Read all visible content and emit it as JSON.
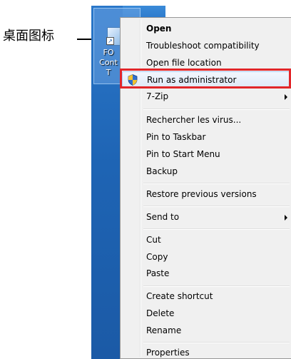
{
  "annotation": {
    "label": "桌面图标"
  },
  "desktop_icon": {
    "lines": [
      "FO",
      "Cont",
      "T"
    ]
  },
  "context_menu": {
    "items": [
      {
        "label": "Open",
        "bold": true
      },
      {
        "label": "Troubleshoot compatibility"
      },
      {
        "label": "Open file location"
      },
      {
        "label": "Run as administrator",
        "icon": "uac-shield-icon",
        "highlighted": true
      },
      {
        "label": "7-Zip",
        "submenu": true
      },
      {
        "label": "Rechercher les virus..."
      },
      {
        "label": "Pin to Taskbar"
      },
      {
        "label": "Pin to Start Menu"
      },
      {
        "label": "Backup"
      },
      {
        "label": "Restore previous versions"
      },
      {
        "label": "Send to",
        "submenu": true
      },
      {
        "label": "Cut"
      },
      {
        "label": "Copy"
      },
      {
        "label": "Paste"
      },
      {
        "label": "Create shortcut"
      },
      {
        "label": "Delete"
      },
      {
        "label": "Rename"
      },
      {
        "label": "Properties"
      }
    ]
  },
  "colors": {
    "highlight_box": "#e2262a",
    "desktop_blue": "#1e64b4",
    "menu_bg": "#f0f0f0"
  }
}
